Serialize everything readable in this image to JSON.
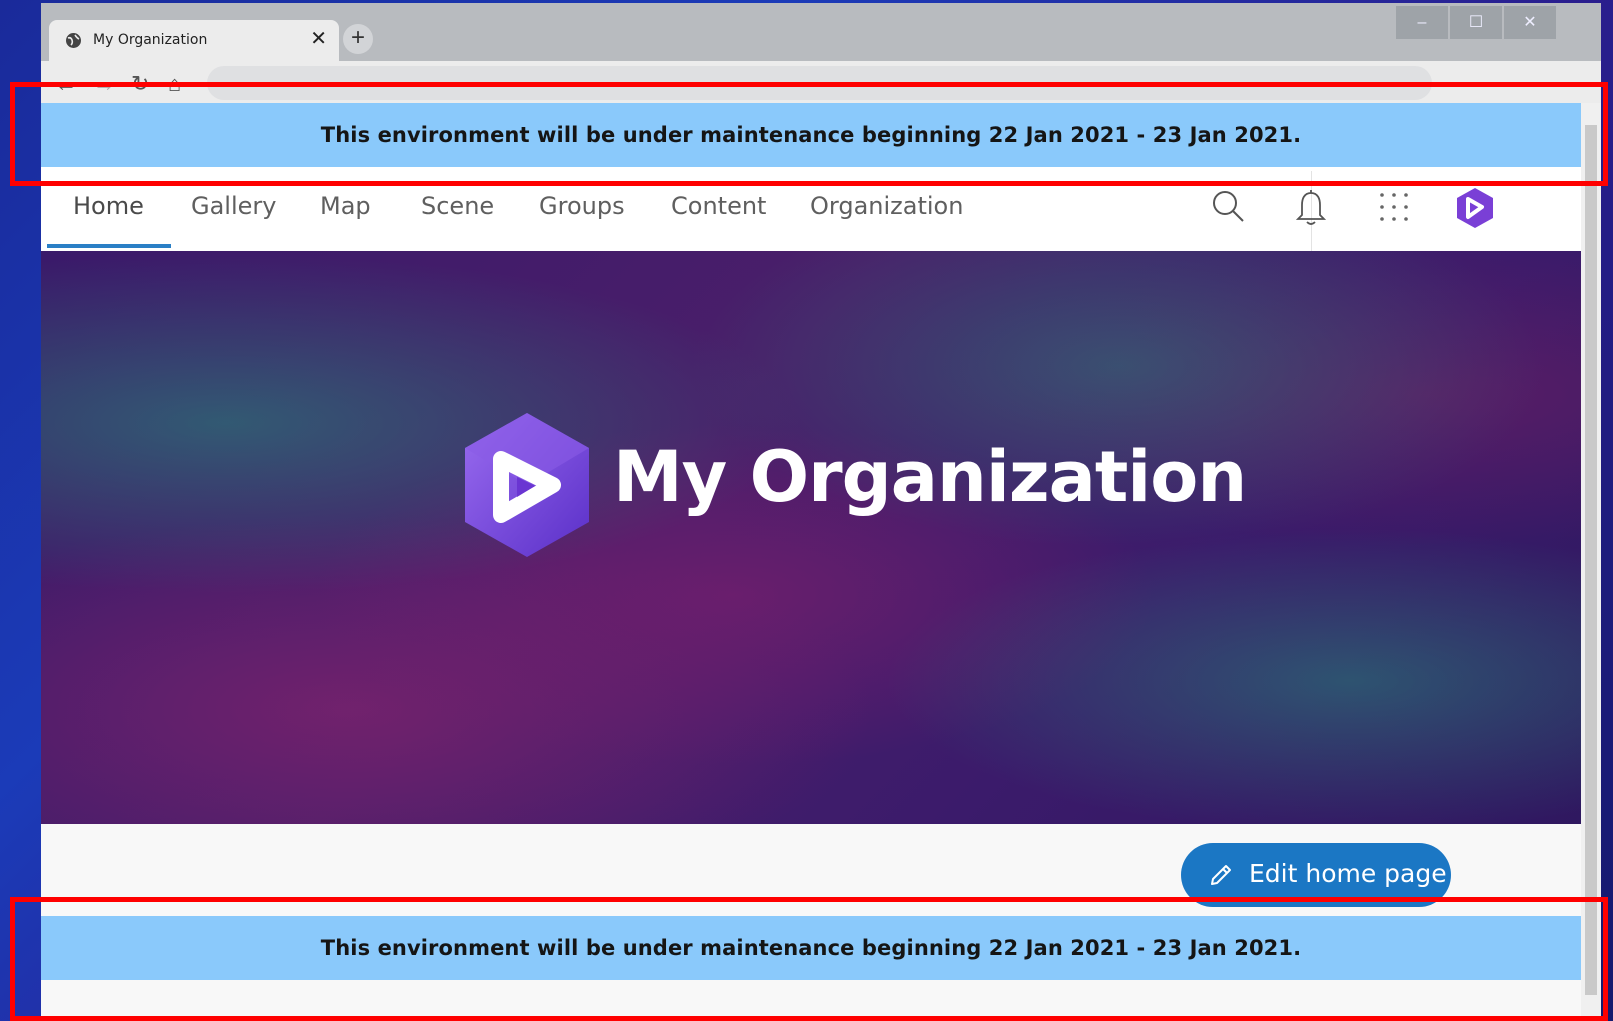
{
  "browser": {
    "tab_title": "My Organization",
    "tab_close": "✕",
    "new_tab": "+",
    "window_controls": {
      "minimize": "–",
      "maximize": "☐",
      "close": "✕"
    },
    "nav_buttons": {
      "back": "←",
      "forward": "→",
      "reload": "↻",
      "home": "⌂"
    }
  },
  "banner": {
    "message": "This environment will be under maintenance beginning 22 Jan 2021 - 23 Jan 2021."
  },
  "nav": {
    "items": [
      {
        "label": "Home",
        "active": true
      },
      {
        "label": "Gallery"
      },
      {
        "label": "Map"
      },
      {
        "label": "Scene"
      },
      {
        "label": "Groups"
      },
      {
        "label": "Content"
      },
      {
        "label": "Organization"
      }
    ],
    "icons": [
      "search-icon",
      "notification-bell-icon",
      "app-launcher-icon",
      "user-avatar-icon"
    ]
  },
  "hero": {
    "title": "My Organization"
  },
  "edit": {
    "label": "Edit home page"
  },
  "colors": {
    "banner_bg": "#8ac9fb",
    "accent": "#1b77c4",
    "highlight": "#ff0000",
    "logo_purple": "#6c3fd8"
  }
}
